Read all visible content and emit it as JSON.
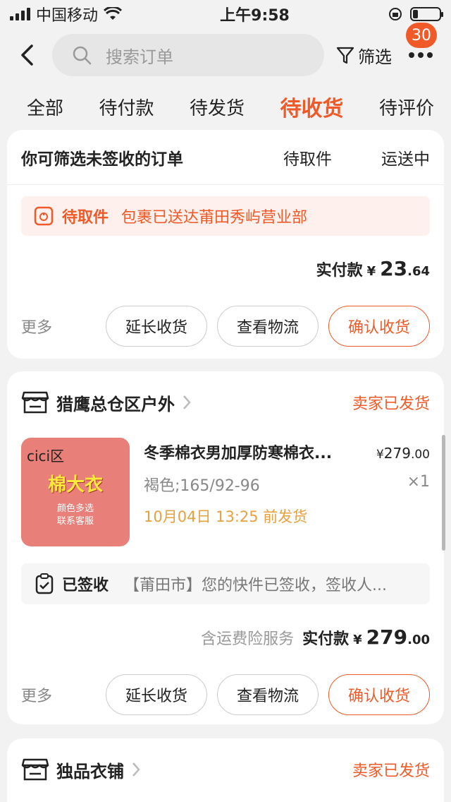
{
  "status_bar": {
    "carrier": "中国移动",
    "time": "上午9:58"
  },
  "nav": {
    "search_placeholder": "搜索订单",
    "filter_label": "筛选",
    "badge_count": "30"
  },
  "tabs": [
    {
      "label": "全部",
      "active": false
    },
    {
      "label": "待付款",
      "active": false
    },
    {
      "label": "待发货",
      "active": false
    },
    {
      "label": "待收货",
      "active": true
    },
    {
      "label": "待评价",
      "active": false
    }
  ],
  "filter_bar": {
    "title": "你可筛选未签收的订单",
    "options": [
      "待取件",
      "运送中"
    ]
  },
  "order1": {
    "notice_status": "待取件",
    "notice_text": "包裹已送达莆田秀屿营业部",
    "total_label": "实付款",
    "currency": "¥",
    "total_int": "23",
    "total_dec": ".64",
    "more": "更多",
    "buttons": [
      "延长收货",
      "查看物流",
      "确认收货"
    ]
  },
  "order2": {
    "shop_name": "猎鹰总仓区户外",
    "shop_status": "卖家已发货",
    "thumb_brand": "cici区",
    "thumb_main": "棉大衣",
    "thumb_sub1": "颜色多选",
    "thumb_sub2": "联系客服",
    "title": "冬季棉衣男加厚防寒棉衣...",
    "price_currency": "¥",
    "price_int": "279",
    "price_dec": ".00",
    "sku": "褐色;165/92-96",
    "qty": "×1",
    "ship_by": "10月04日 13:25 前发货",
    "logistics_status": "已签收",
    "logistics_detail": "【莆田市】您的快件已签收，签收人...",
    "service_note": "含运费险服务",
    "total_label": "实付款",
    "currency": "¥",
    "total_int": "279",
    "total_dec": ".00",
    "more": "更多",
    "buttons": [
      "延长收货",
      "查看物流",
      "确认收货"
    ]
  },
  "order3": {
    "shop_name": "独品衣铺",
    "shop_status": "卖家已发货"
  },
  "colors": {
    "accent": "#f05a28",
    "ship_time": "#e8a040"
  }
}
